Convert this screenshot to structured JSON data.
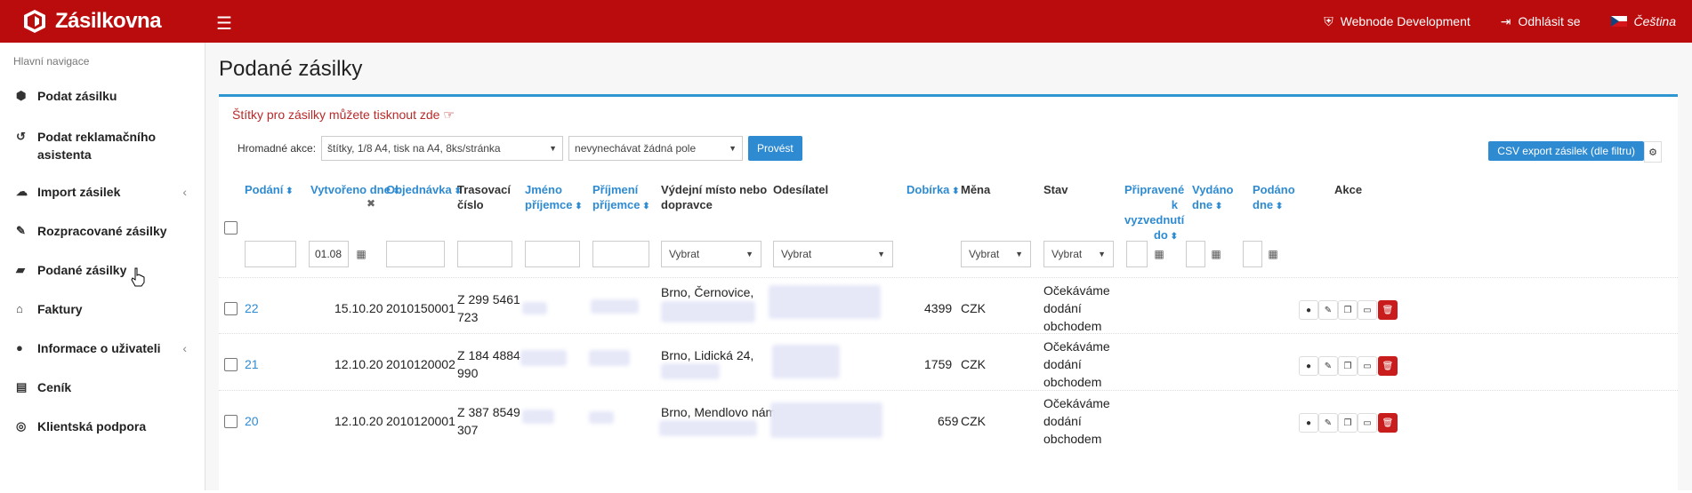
{
  "brand": {
    "name": "Zásilkovna"
  },
  "topbar": {
    "account": "Webnode Development",
    "logout": "Odhlásit se",
    "language": "Čeština"
  },
  "sidebar": {
    "heading": "Hlavní navigace",
    "items": [
      {
        "label": "Podat zásilku",
        "icon": "box-icon"
      },
      {
        "label": "Podat reklamačního asistenta",
        "icon": "undo-icon"
      },
      {
        "label": "Import zásilek",
        "icon": "cloud-upload-icon"
      },
      {
        "label": "Rozpracované zásilky",
        "icon": "edit-icon"
      },
      {
        "label": "Podané zásilky",
        "icon": "archive-icon"
      },
      {
        "label": "Faktury",
        "icon": "bank-icon"
      },
      {
        "label": "Informace o uživateli",
        "icon": "user-icon"
      },
      {
        "label": "Ceník",
        "icon": "list-icon"
      },
      {
        "label": "Klientská podpora",
        "icon": "lifebuoy-icon"
      }
    ]
  },
  "page": {
    "title": "Podané zásilky",
    "notice": "Štítky pro zásilky můžete tisknout zde"
  },
  "bulk": {
    "label": "Hromadné akce:",
    "format": "štítky, 1/8 A4, tisk na A4, 8ks/stránka",
    "skip": "nevynechávat žádná pole",
    "submit": "Provést",
    "csv": "CSV export zásilek (dle filtru)"
  },
  "columns": {
    "podani": "Podání",
    "vytvoreno": "Vytvořeno dne",
    "objednavka": "Objednávka",
    "trasovaci": "Trasovací číslo",
    "jmeno": "Jméno příjemce",
    "prijmeni": "Příjmení příjemce",
    "vydejni": "Výdejní místo nebo dopravce",
    "odesilatel": "Odesílatel",
    "dobirka": "Dobírka",
    "mena": "Měna",
    "stav": "Stav",
    "pripravene": "Připravené k vyzvednutí do",
    "vydano": "Vydáno dne",
    "podano": "Podáno dne",
    "akce": "Akce"
  },
  "filters": {
    "created_value": "01.08",
    "select_placeholder": "Vybrat"
  },
  "rows": [
    {
      "podani": "22",
      "vytvoreno": "15.10.20",
      "objednavka": "2010150001",
      "trasovaci_1": "Z 299 5461",
      "trasovaci_2": "723",
      "vydejni": "Brno, Černovice,",
      "dobirka": "4399",
      "mena": "CZK",
      "stav_1": "Očekáváme",
      "stav_2": "dodání",
      "stav_3": "obchodem"
    },
    {
      "podani": "21",
      "vytvoreno": "12.10.20",
      "objednavka": "2010120002",
      "trasovaci_1": "Z 184 4884",
      "trasovaci_2": "990",
      "vydejni": "Brno, Lidická 24,",
      "dobirka": "1759",
      "mena": "CZK",
      "stav_1": "Očekáváme",
      "stav_2": "dodání",
      "stav_3": "obchodem"
    },
    {
      "podani": "20",
      "vytvoreno": "12.10.20",
      "objednavka": "2010120001",
      "trasovaci_1": "Z 387 8549",
      "trasovaci_2": "307",
      "vydejni": "Brno, Mendlovo nám.",
      "dobirka": "659",
      "mena": "CZK",
      "stav_1": "Očekáváme",
      "stav_2": "dodání",
      "stav_3": "obchodem"
    }
  ],
  "colors": {
    "brand_red": "#ba0c0c",
    "link_blue": "#2f8bd1",
    "accent_blue": "#2f96d1",
    "delete_red": "#c91c1c"
  }
}
